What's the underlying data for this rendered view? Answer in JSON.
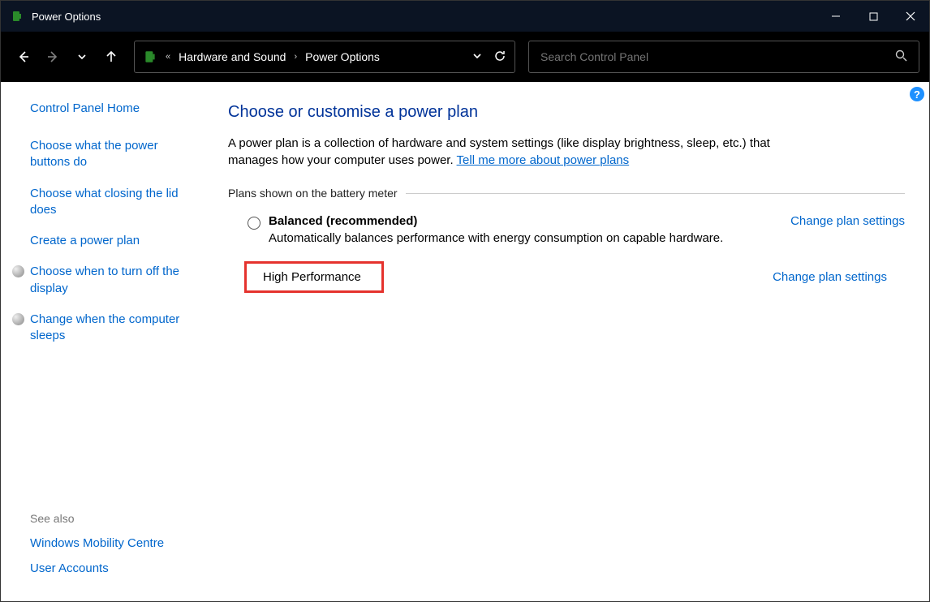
{
  "window": {
    "title": "Power Options"
  },
  "breadcrumb": {
    "parent": "Hardware and Sound",
    "current": "Power Options"
  },
  "search": {
    "placeholder": "Search Control Panel"
  },
  "sidebar": {
    "home": "Control Panel Home",
    "links": [
      "Choose what the power buttons do",
      "Choose what closing the lid does",
      "Create a power plan",
      "Choose when to turn off the display",
      "Change when the computer sleeps"
    ],
    "see_also_header": "See also",
    "see_also": [
      "Windows Mobility Centre",
      "User Accounts"
    ]
  },
  "main": {
    "title": "Choose or customise a power plan",
    "desc_prefix": "A power plan is a collection of hardware and system settings (like display brightness, sleep, etc.) that manages how your computer uses power. ",
    "desc_link": "Tell me more about power plans",
    "plans_header": "Plans shown on the battery meter",
    "change_settings": "Change plan settings",
    "plans": [
      {
        "name": "Balanced (recommended)",
        "desc": "Automatically balances performance with energy consumption on capable hardware.",
        "selected": false,
        "bold": true
      },
      {
        "name": "High Performance",
        "desc": "",
        "selected": true,
        "bold": false
      }
    ]
  }
}
